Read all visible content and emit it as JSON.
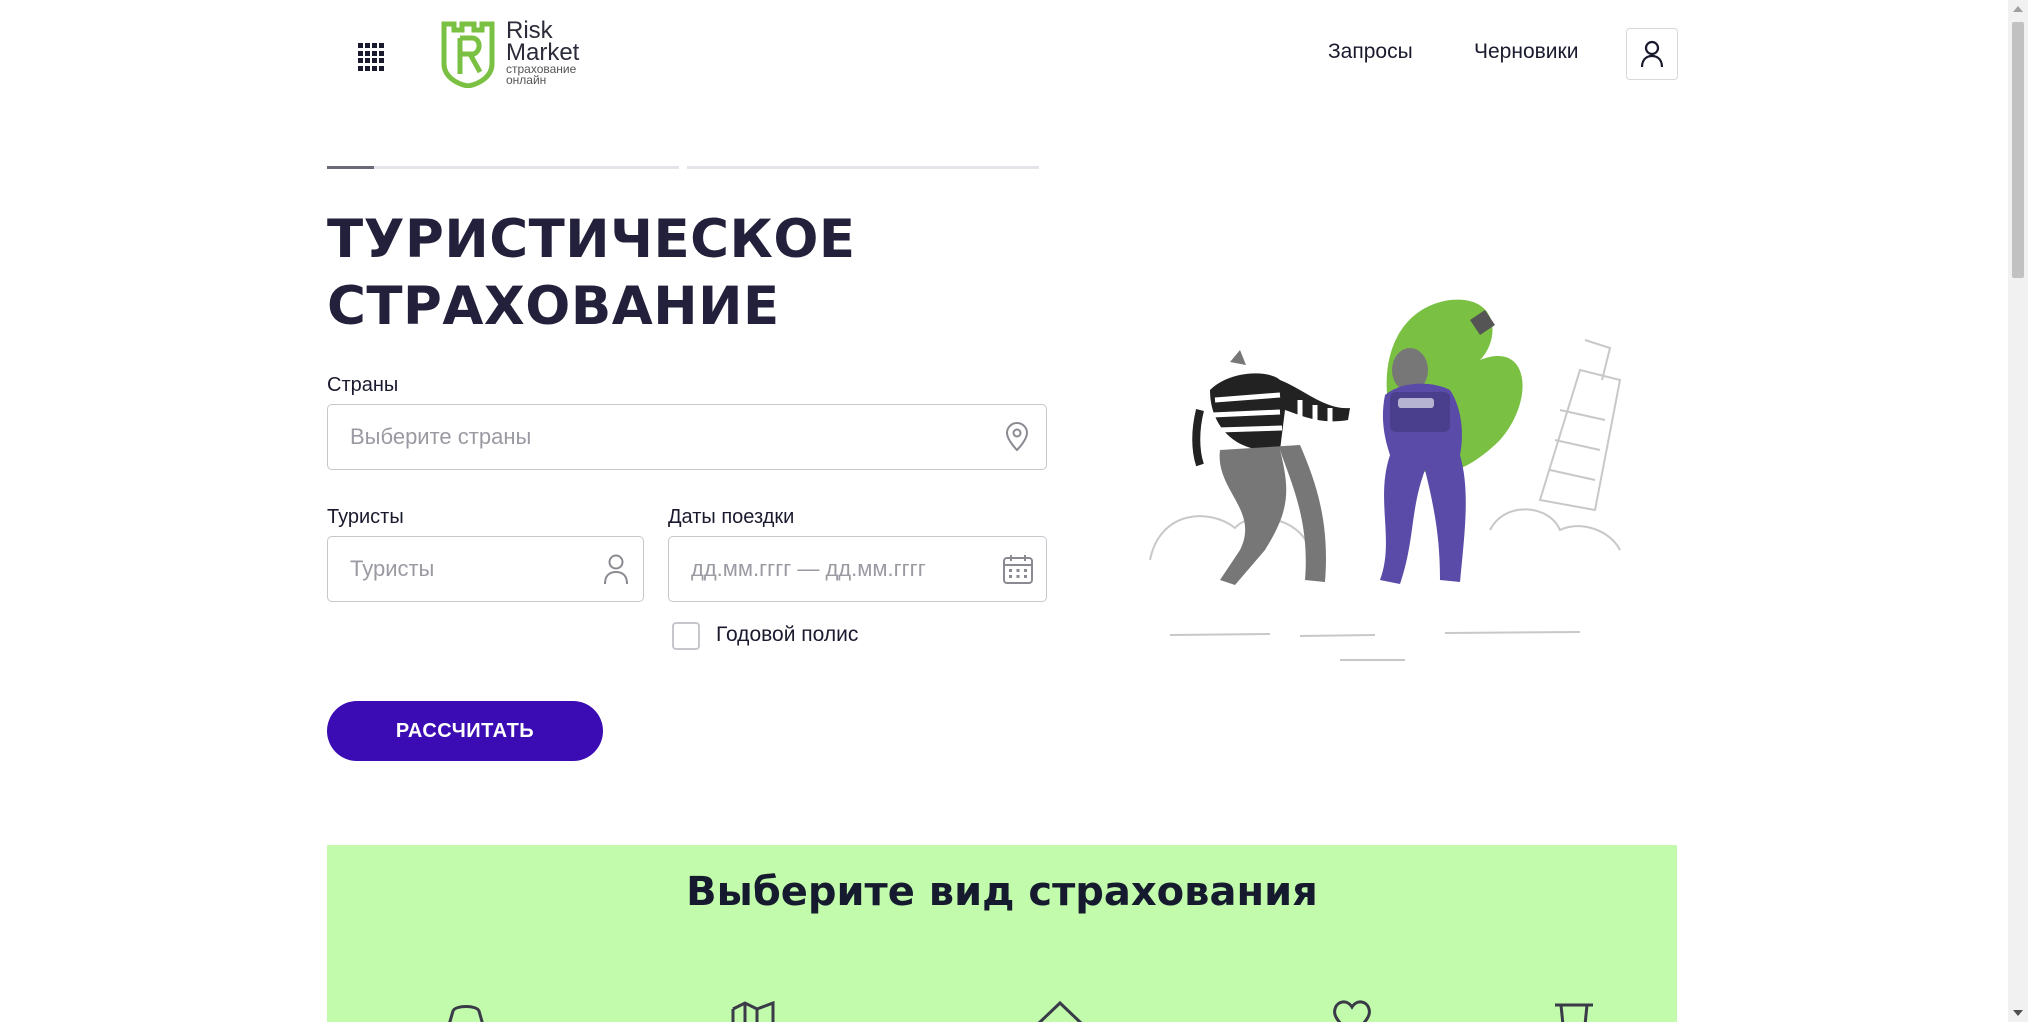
{
  "header": {
    "logo": {
      "line1": "Risk",
      "line2": "Market",
      "sub1": "страхование",
      "sub2": "онлайн"
    },
    "nav": {
      "requests": "Запросы",
      "drafts": "Черновики"
    }
  },
  "form": {
    "title_line1": "ТУРИСТИЧЕСКОЕ",
    "title_line2": "СТРАХОВАНИЕ",
    "countries": {
      "label": "Страны",
      "placeholder": "Выберите страны",
      "value": ""
    },
    "tourists": {
      "label": "Туристы",
      "placeholder": "Туристы",
      "value": ""
    },
    "dates": {
      "label": "Даты поездки",
      "placeholder": "дд.мм.гггг — дд.мм.гггг",
      "value": ""
    },
    "annual_policy": {
      "label": "Годовой полис",
      "checked": false
    },
    "submit_label": "РАССЧИТАТЬ"
  },
  "insurance_types": {
    "title": "Выберите вид страхования",
    "icons": [
      "car-icon",
      "map-icon",
      "house-icon",
      "heart-icon",
      "trophy-icon"
    ]
  },
  "colors": {
    "primary": "#3b0bb3",
    "brand_green": "#7ac143",
    "section_bg": "#c1fbab",
    "title": "#22203a"
  }
}
